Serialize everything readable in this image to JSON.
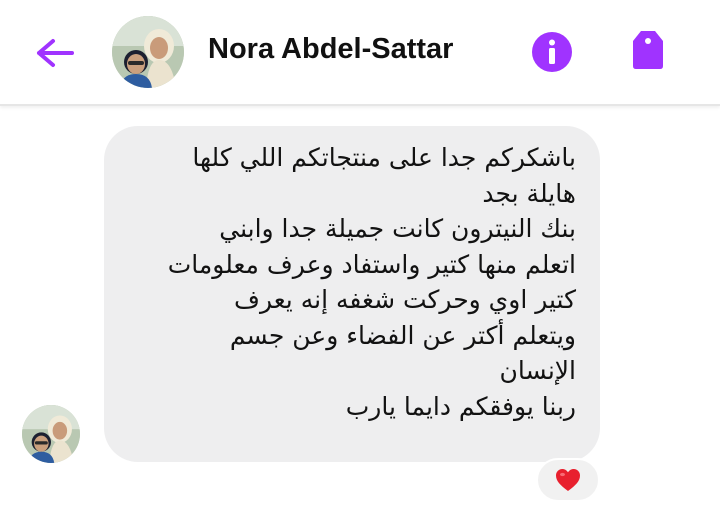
{
  "header": {
    "contact_name": "Nora Abdel-Sattar",
    "back_icon": "arrow-left-icon",
    "info_icon": "info-icon",
    "tag_icon": "tag-icon"
  },
  "message": {
    "direction": "incoming",
    "lines": [
      "باشكركم جدا على منتجاتكم اللي كلها",
      "هايلة بجد",
      "بنك النيترون كانت جميلة جدا وابني",
      "اتعلم منها كتير واستفاد وعرف معلومات",
      "كتير اوي وحركت شغفه إنه يعرف",
      "ويتعلم أكتر عن الفضاء وعن جسم",
      "الإنسان",
      "ربنا يوفقكم دايما يارب"
    ],
    "reaction": "heart"
  },
  "colors": {
    "accent": "#a033ff",
    "bubble": "#eeeeef",
    "reaction": "#e8202e",
    "text": "#121212"
  }
}
